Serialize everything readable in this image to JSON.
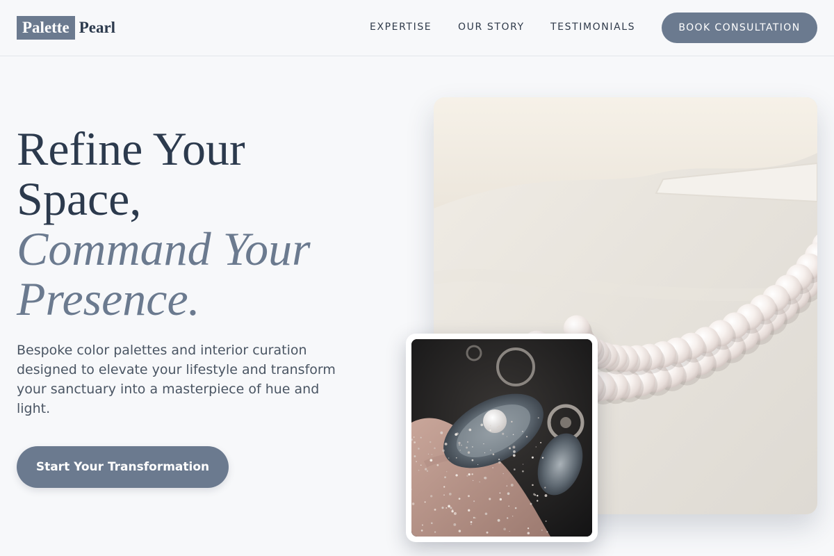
{
  "brand": {
    "box": "Palette",
    "text": "Pearl"
  },
  "nav": {
    "links": [
      "EXPERTISE",
      "OUR STORY",
      "TESTIMONIALS"
    ],
    "cta": "BOOK CONSULTATION"
  },
  "hero": {
    "line1": "Refine Your",
    "line2": "Space,",
    "accent1": "Command Your",
    "accent2": "Presence.",
    "body": "Bespoke color palettes and interior curation designed to elevate your lifestyle and transform your sanctuary into a masterpiece of hue and light.",
    "cta": "Start Your Transformation"
  },
  "images": {
    "main_icon": "pearl-necklace-photo",
    "inset_icon": "oyster-pearl-photo"
  },
  "colors": {
    "accent": "#6b7a8f",
    "text": "#2c3a4d",
    "background": "#f7f8fa"
  }
}
